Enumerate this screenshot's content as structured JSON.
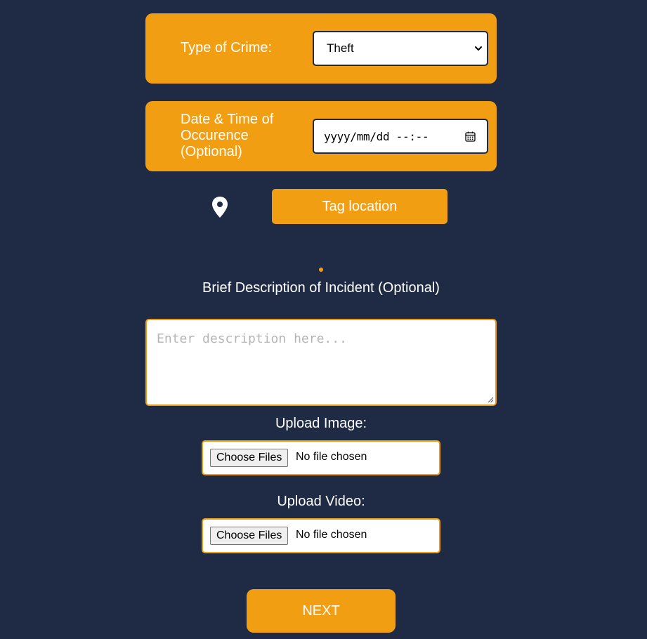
{
  "crime_type": {
    "label": "Type of Crime:",
    "selected": "Theft"
  },
  "occurrence": {
    "label": "Date & Time of Occurence (Optional)",
    "placeholder": "yyyy/mm/dd --:--"
  },
  "location": {
    "button_label": "Tag location"
  },
  "description": {
    "label": "Brief Description of Incident (Optional)",
    "placeholder": "Enter description here..."
  },
  "upload_image": {
    "label": "Upload Image:",
    "button_label": "Choose Files",
    "status": "No file chosen"
  },
  "upload_video": {
    "label": "Upload Video:",
    "button_label": "Choose Files",
    "status": "No file chosen"
  },
  "next_label": "NEXT",
  "colors": {
    "background": "#1f2a44",
    "accent": "#f29e12",
    "text_light": "#ffffff"
  },
  "icons": {
    "location": "map-pin-icon",
    "calendar": "calendar-icon",
    "select": "chevron-down-icon"
  }
}
